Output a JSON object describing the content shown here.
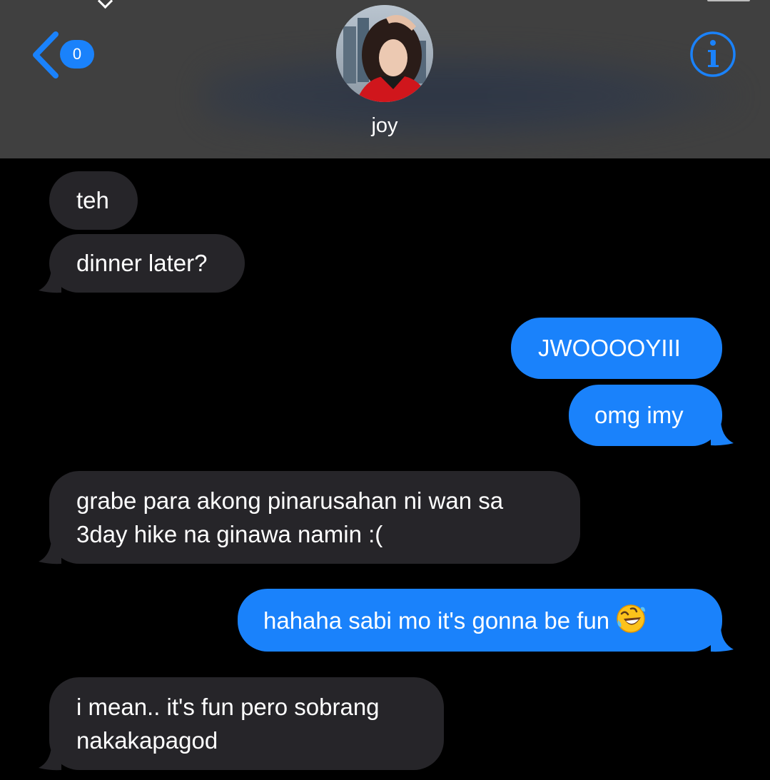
{
  "header": {
    "back_badge": "0",
    "contact_name": "joy",
    "avatar": "contact-photo",
    "back_icon": "chevron-left-icon",
    "info_icon": "info-icon"
  },
  "colors": {
    "header_bg": "#404040",
    "accent": "#1a82fb",
    "received_bubble": "#262529",
    "background": "#000000"
  },
  "messages": [
    {
      "direction": "received",
      "text": "teh"
    },
    {
      "direction": "received",
      "text": "dinner later?"
    },
    {
      "direction": "sent",
      "text": "JWOOOOYIII"
    },
    {
      "direction": "sent",
      "text": "omg imy"
    },
    {
      "direction": "received",
      "lines": [
        "grabe para akong pinarusahan ni wan sa",
        "3day hike na ginawa namin :("
      ]
    },
    {
      "direction": "sent",
      "text": "hahaha sabi mo it's gonna be fun",
      "emoji": "rolling-on-floor-laughing-emoji"
    },
    {
      "direction": "received",
      "lines": [
        "i mean.. it's fun pero sobrang",
        "nakakapagod"
      ]
    }
  ]
}
